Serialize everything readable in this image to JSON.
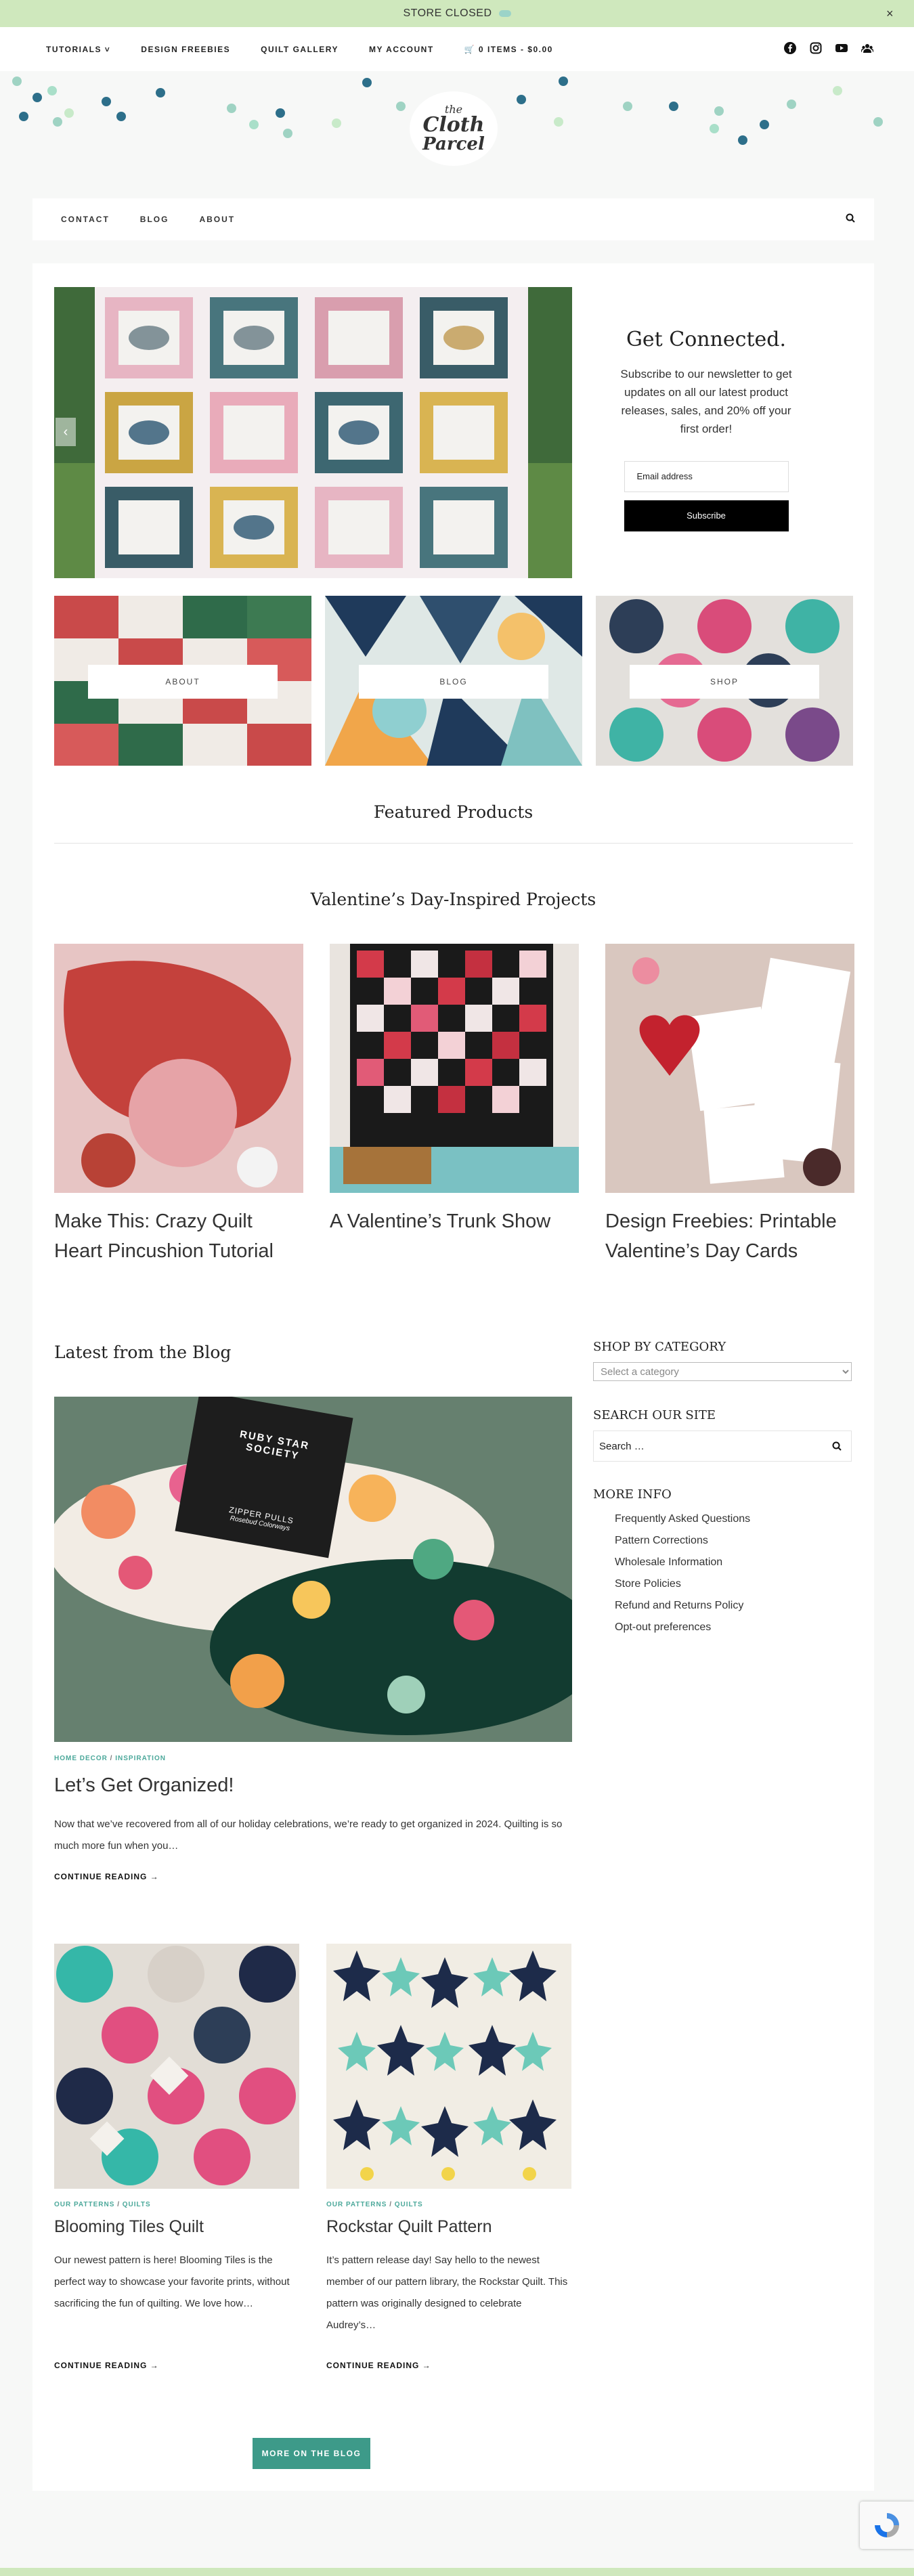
{
  "notice": {
    "text": "STORE CLOSED",
    "close": "×"
  },
  "topnav": {
    "items": [
      "TUTORIALS ˅",
      "DESIGN FREEBIES",
      "QUILT GALLERY",
      "MY ACCOUNT",
      "🛒 0 ITEMS - $0.00"
    ],
    "social": [
      "facebook-icon",
      "instagram-icon",
      "youtube-icon",
      "community-icon"
    ]
  },
  "logo": {
    "line1": "the",
    "line2": "Cloth",
    "line3": "Parcel"
  },
  "secnav": {
    "items": [
      "CONTACT",
      "BLOG",
      "ABOUT"
    ]
  },
  "hero": {
    "prev": "‹"
  },
  "newsletter": {
    "title": "Get Connected.",
    "text": "Subscribe to our newsletter to get updates on all our latest product releases, sales, and 20% off your first order!",
    "email_placeholder": "Email address",
    "button": "Subscribe"
  },
  "tiles": [
    {
      "label": "ABOUT"
    },
    {
      "label": "BLOG"
    },
    {
      "label": "SHOP"
    }
  ],
  "featured": {
    "title": "Featured Products"
  },
  "valentine": {
    "title": "Valentine’s Day-Inspired Projects",
    "cards": [
      {
        "title": "Make This: Crazy Quilt Heart Pincushion Tutorial"
      },
      {
        "title": "A Valentine’s Trunk Show"
      },
      {
        "title": "Design Freebies: Printable Valentine’s Day Cards"
      }
    ]
  },
  "blog": {
    "heading": "Latest from the Blog",
    "featured_post": {
      "cat1": "HOME DECOR",
      "sep": " / ",
      "cat2": "INSPIRATION",
      "title": "Let’s Get Organized!",
      "excerpt": "Now that we’ve recovered from all of our holiday celebrations, we’re ready to get organized in 2024. Quilting is so much more fun when you…",
      "more": "CONTINUE READING →",
      "image_card": {
        "l1": "RUBY STAR",
        "l2": "SOCIETY",
        "l3": "ZIPPER PULLS",
        "l4": "Rosebud Colorways"
      }
    },
    "posts": [
      {
        "cat1": "OUR PATTERNS",
        "sep": " / ",
        "cat2": "QUILTS",
        "title": "Blooming Tiles Quilt",
        "excerpt": "Our newest pattern is here! Blooming Tiles is the perfect way to showcase your favorite prints, without sacrificing the fun of quilting. We love how…",
        "more": "CONTINUE READING →"
      },
      {
        "cat1": "OUR PATTERNS",
        "sep": " / ",
        "cat2": "QUILTS",
        "title": "Rockstar Quilt Pattern",
        "excerpt": "It’s pattern release day! Say hello to the newest member of our pattern library, the Rockstar Quilt. This pattern was originally designed to celebrate Audrey’s…",
        "more": "CONTINUE READING →"
      }
    ],
    "more_button": "MORE ON THE BLOG"
  },
  "sidebar": {
    "category_title": "SHOP BY CATEGORY",
    "category_select": "Select a category",
    "search_title": "SEARCH OUR SITE",
    "search_placeholder": "Search …",
    "info_title": "MORE INFO",
    "links": [
      "Frequently Asked Questions",
      "Pattern Corrections",
      "Wholesale Information",
      "Store Policies",
      "Refund and Returns Policy",
      "Opt-out preferences"
    ]
  },
  "colors": {
    "accent": "#3d9a89",
    "notice_bg": "#cfe8bd",
    "dark": "#000000"
  }
}
